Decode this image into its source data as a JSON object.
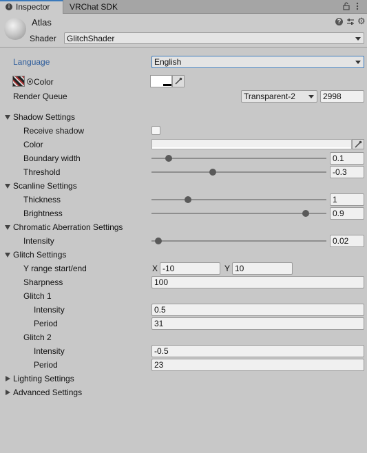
{
  "tabs": {
    "inspector": "Inspector",
    "vrchat_sdk": "VRChat SDK"
  },
  "header": {
    "name": "Atlas",
    "shader_label": "Shader",
    "shader_value": "GlitchShader"
  },
  "language": {
    "label": "Language",
    "value": "English"
  },
  "color": {
    "label": "Color"
  },
  "render_queue": {
    "label": "Render Queue",
    "dropdown": "Transparent-2",
    "value": "2998"
  },
  "shadow": {
    "title": "Shadow Settings",
    "receive_label": "Receive shadow",
    "color_label": "Color",
    "boundary_label": "Boundary width",
    "boundary_value": "0.1",
    "boundary_level": 0.1,
    "threshold_label": "Threshold",
    "threshold_value": "-0.3",
    "threshold_level": 0.35
  },
  "scanline": {
    "title": "Scanline Settings",
    "thickness_label": "Thickness",
    "thickness_value": "1",
    "thickness_level": 0.21,
    "brightness_label": "Brightness",
    "brightness_value": "0.9",
    "brightness_level": 0.88
  },
  "chromatic": {
    "title": "Chromatic Aberration Settings",
    "intensity_label": "Intensity",
    "intensity_value": "0.02",
    "intensity_level": 0.04
  },
  "glitch": {
    "title": "Glitch Settings",
    "yrange_label": "Y range start/end",
    "x_label": "X",
    "x_value": "-10",
    "y_label": "Y",
    "y_value": "10",
    "sharpness_label": "Sharpness",
    "sharpness_value": "100",
    "glitch1_label": "Glitch 1",
    "g1_intensity_label": "Intensity",
    "g1_intensity_value": "0.5",
    "g1_period_label": "Period",
    "g1_period_value": "31",
    "glitch2_label": "Glitch 2",
    "g2_intensity_label": "Intensity",
    "g2_intensity_value": "-0.5",
    "g2_period_label": "Period",
    "g2_period_value": "23"
  },
  "lighting": {
    "title": "Lighting Settings"
  },
  "advanced": {
    "title": "Advanced Settings"
  },
  "icons": [
    "info-icon",
    "lock-icon",
    "more-menu-icon",
    "help-icon",
    "preset-icon",
    "settings-icon",
    "eyedropper-icon",
    "target-icon"
  ]
}
